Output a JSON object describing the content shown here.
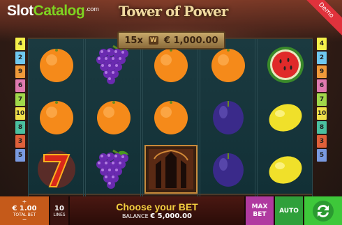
{
  "header": {
    "logo_slot": "Slot",
    "logo_catalog": "Catalog",
    "logo_com": ".com",
    "title": "Tower of Power",
    "demo": "Demo"
  },
  "win_banner": {
    "multiplier": "15x",
    "multiplier_symbol": "W",
    "amount": "€ 1,000.00"
  },
  "paylines_left": [
    "4",
    "2",
    "9",
    "6",
    "7",
    "10",
    "8",
    "3",
    "5"
  ],
  "paylines_right": [
    "4",
    "2",
    "9",
    "6",
    "7",
    "10",
    "8",
    "3",
    "5"
  ],
  "payline_colors": [
    "#f4f04a",
    "#6fc8f0",
    "#f09a3a",
    "#e07ab0",
    "#a0d84a",
    "#f0e04a",
    "#4ac0a0",
    "#e0603a",
    "#7a9ae0"
  ],
  "reels": [
    [
      "orange",
      "orange",
      "seven"
    ],
    [
      "grapes",
      "orange",
      "grapes"
    ],
    [
      "orange",
      "orange",
      "tower"
    ],
    [
      "orange",
      "plum",
      "plum"
    ],
    [
      "watermelon",
      "lemon",
      "lemon"
    ]
  ],
  "bottom": {
    "bet_plus": "+",
    "bet_value": "€ 1.00",
    "bet_label": "TOTAL BET",
    "bet_minus": "−",
    "lines_value": "10",
    "lines_label": "LINES",
    "choose": "Choose your BET",
    "balance_label": "BALANCE",
    "balance_value": "€ 5,000.00",
    "maxbet": "MAX BET",
    "auto": "AUTO"
  },
  "colors": {
    "orange": "#f58a1a",
    "plum": "#3a2a8a",
    "lemon": "#f0e02a",
    "grapes": "#6a2ab0",
    "accent": "#f5d040"
  }
}
